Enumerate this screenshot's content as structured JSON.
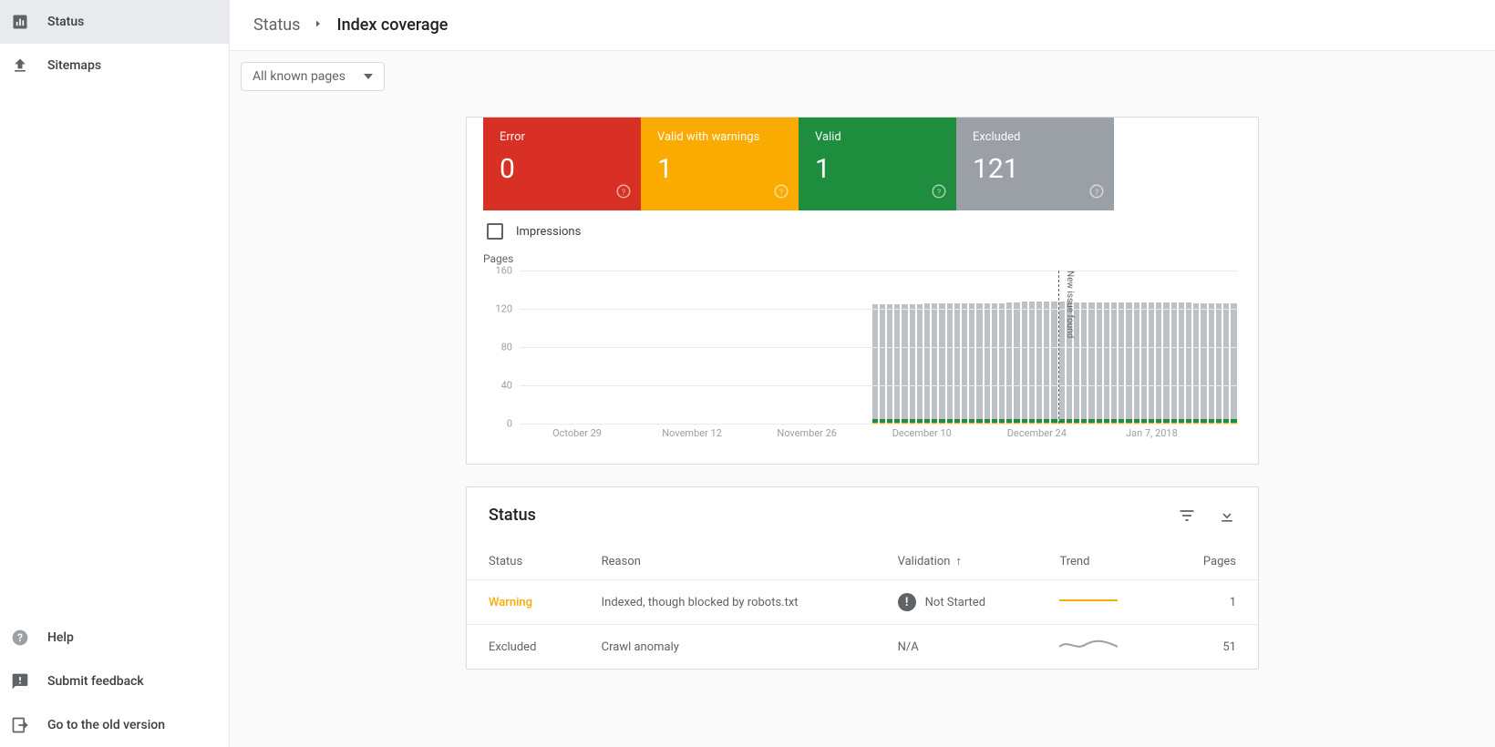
{
  "sidebar": {
    "items": [
      {
        "label": "Status",
        "icon": "chart-icon",
        "active": true
      },
      {
        "label": "Sitemaps",
        "icon": "upload-icon",
        "active": false
      }
    ],
    "footer": [
      {
        "label": "Help",
        "icon": "help-icon"
      },
      {
        "label": "Submit feedback",
        "icon": "feedback-icon"
      },
      {
        "label": "Go to the old version",
        "icon": "exit-icon"
      }
    ]
  },
  "breadcrumb": {
    "parent": "Status",
    "current": "Index coverage"
  },
  "filter": {
    "selected": "All known pages"
  },
  "metrics": {
    "error": {
      "label": "Error",
      "value": "0"
    },
    "warnings": {
      "label": "Valid with warnings",
      "value": "1"
    },
    "valid": {
      "label": "Valid",
      "value": "1"
    },
    "excluded": {
      "label": "Excluded",
      "value": "121"
    }
  },
  "impressions_label": "Impressions",
  "chart_data": {
    "type": "bar",
    "title": "Pages",
    "ylabel": "Pages",
    "ylim": [
      0,
      160
    ],
    "y_ticks": [
      0,
      40,
      80,
      120,
      160
    ],
    "categories": [
      "October 29",
      "November 12",
      "November 26",
      "December 10",
      "December 24",
      "Jan 7, 2018"
    ],
    "series": [
      {
        "name": "Excluded",
        "color": "#bdc1c6",
        "values": [
          0,
          0,
          0,
          0,
          0,
          0,
          0,
          0,
          0,
          0,
          0,
          0,
          0,
          0,
          0,
          0,
          0,
          0,
          0,
          0,
          0,
          0,
          0,
          0,
          0,
          0,
          0,
          0,
          0,
          0,
          0,
          0,
          0,
          0,
          0,
          0,
          0,
          0,
          0,
          0,
          0,
          0,
          0,
          0,
          0,
          0,
          0,
          120,
          120,
          120,
          120,
          120,
          120,
          120,
          121,
          121,
          121,
          121,
          121,
          121,
          121,
          121,
          121,
          121,
          121,
          122,
          122,
          123,
          123,
          123,
          123,
          123,
          123,
          123,
          122,
          122,
          122,
          122,
          122,
          122,
          122,
          122,
          122,
          122,
          122,
          122,
          122,
          122,
          122,
          122,
          121,
          121,
          121,
          121,
          121,
          121
        ]
      },
      {
        "name": "Valid",
        "color": "#1e8e3e",
        "values": [
          0,
          0,
          0,
          0,
          0,
          0,
          0,
          0,
          0,
          0,
          0,
          0,
          0,
          0,
          0,
          0,
          0,
          0,
          0,
          0,
          0,
          0,
          0,
          0,
          0,
          0,
          0,
          0,
          0,
          0,
          0,
          0,
          0,
          0,
          0,
          0,
          0,
          0,
          0,
          0,
          0,
          0,
          0,
          0,
          0,
          0,
          0,
          4,
          4,
          4,
          4,
          4,
          4,
          4,
          4,
          4,
          4,
          4,
          4,
          4,
          4,
          4,
          4,
          4,
          4,
          4,
          4,
          4,
          4,
          4,
          4,
          4,
          4,
          4,
          4,
          4,
          4,
          4,
          4,
          4,
          4,
          4,
          4,
          4,
          4,
          4,
          4,
          4,
          4,
          4,
          4,
          4,
          4,
          4,
          4,
          4
        ]
      },
      {
        "name": "Valid with warnings",
        "color": "#f9ab00",
        "values": [
          0,
          0,
          0,
          0,
          0,
          0,
          0,
          0,
          0,
          0,
          0,
          0,
          0,
          0,
          0,
          0,
          0,
          0,
          0,
          0,
          0,
          0,
          0,
          0,
          0,
          0,
          0,
          0,
          0,
          0,
          0,
          0,
          0,
          0,
          0,
          0,
          0,
          0,
          0,
          0,
          0,
          0,
          0,
          0,
          0,
          0,
          0,
          1,
          1,
          1,
          1,
          1,
          1,
          1,
          1,
          1,
          1,
          1,
          1,
          1,
          1,
          1,
          1,
          1,
          1,
          1,
          1,
          1,
          1,
          1,
          1,
          1,
          1,
          1,
          1,
          1,
          1,
          1,
          1,
          1,
          1,
          1,
          1,
          1,
          1,
          1,
          1,
          1,
          1,
          1,
          1,
          1,
          1,
          1,
          1,
          1
        ]
      }
    ],
    "annotation": {
      "label": "New issue found",
      "index": 72
    }
  },
  "status_table": {
    "title": "Status",
    "columns": [
      "Status",
      "Reason",
      "Validation",
      "Trend",
      "Pages"
    ],
    "rows": [
      {
        "status": "Warning",
        "status_class": "status-warning",
        "reason": "Indexed, though blocked by robots.txt",
        "validation": "Not Started",
        "validation_icon": true,
        "pages": "1",
        "spark": "flat"
      },
      {
        "status": "Excluded",
        "status_class": "",
        "reason": "Crawl anomaly",
        "validation": "N/A",
        "validation_icon": false,
        "pages": "51",
        "spark": "wavy"
      }
    ]
  }
}
